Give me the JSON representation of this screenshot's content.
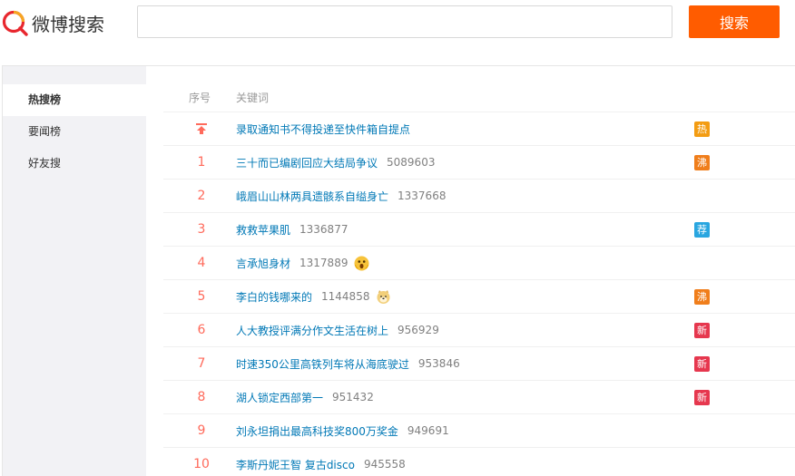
{
  "header": {
    "logo_text": "微博搜索",
    "search_value": "",
    "search_placeholder": "",
    "search_button_label": "搜索"
  },
  "sidebar": {
    "items": [
      {
        "label": "热搜榜",
        "active": true
      },
      {
        "label": "要闻榜",
        "active": false
      },
      {
        "label": "好友搜",
        "active": false
      }
    ]
  },
  "list": {
    "col_rank": "序号",
    "col_keyword": "关键词",
    "rows": [
      {
        "rank": "",
        "rank_icon": "pinned-top-icon",
        "keyword": "录取通知书不得投递至快件箱自提点",
        "count": "",
        "emoji": "",
        "badge": "热",
        "badge_color": "#f39c12"
      },
      {
        "rank": "1",
        "keyword": "三十而已编剧回应大结局争议",
        "count": "5089603",
        "emoji": "",
        "badge": "沸",
        "badge_color": "#f07e1b"
      },
      {
        "rank": "2",
        "keyword": "峨眉山山林两具遗骸系自缢身亡",
        "count": "1337668",
        "emoji": "",
        "badge": "",
        "badge_color": ""
      },
      {
        "rank": "3",
        "keyword": "救救苹果肌",
        "count": "1336877",
        "emoji": "",
        "badge": "荐",
        "badge_color": "#29a6e0"
      },
      {
        "rank": "4",
        "keyword": "言承旭身材",
        "count": "1317889",
        "emoji": "surprised-face-icon",
        "badge": "",
        "badge_color": ""
      },
      {
        "rank": "5",
        "keyword": "李白的钱哪来的",
        "count": "1144858",
        "emoji": "doge-face-icon",
        "badge": "沸",
        "badge_color": "#f07e1b"
      },
      {
        "rank": "6",
        "keyword": "人大教授评满分作文生活在树上",
        "count": "956929",
        "emoji": "",
        "badge": "新",
        "badge_color": "#e6374e"
      },
      {
        "rank": "7",
        "keyword": "时速350公里高铁列车将从海底驶过",
        "count": "953846",
        "emoji": "",
        "badge": "新",
        "badge_color": "#e6374e"
      },
      {
        "rank": "8",
        "keyword": "湖人锁定西部第一",
        "count": "951432",
        "emoji": "",
        "badge": "新",
        "badge_color": "#e6374e"
      },
      {
        "rank": "9",
        "keyword": "刘永坦捐出最高科技奖800万奖金",
        "count": "949691",
        "emoji": "",
        "badge": "",
        "badge_color": ""
      },
      {
        "rank": "10",
        "keyword": "李斯丹妮王智 复古disco",
        "count": "945558",
        "emoji": "",
        "badge": "",
        "badge_color": ""
      }
    ]
  }
}
